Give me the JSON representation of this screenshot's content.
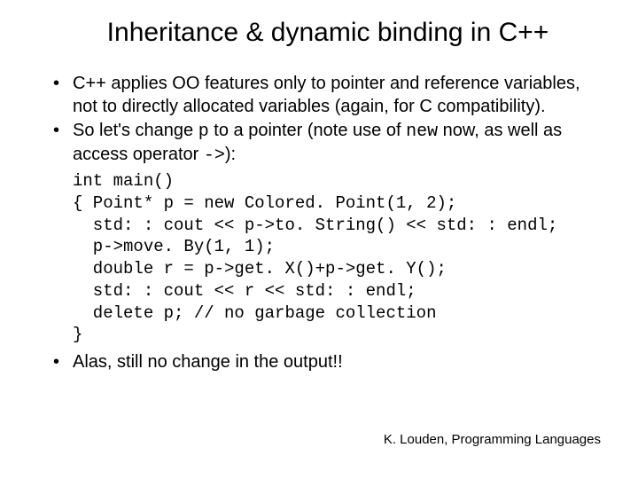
{
  "title": "Inheritance & dynamic binding in C++",
  "bullet1_a": "C++ applies OO features only to pointer and reference variables, not to directly allocated variables (again, for C compatibility).",
  "bullet2_a": "So let's change ",
  "bullet2_code1": "p",
  "bullet2_b": " to a pointer (note use of ",
  "bullet2_code2": "new",
  "bullet2_c": " now, as well as access operator ",
  "bullet2_code3": "->",
  "bullet2_d": "):",
  "code": "int main()\n{ Point* p = new Colored. Point(1, 2);\n  std: : cout << p->to. String() << std: : endl;\n  p->move. By(1, 1);\n  double r = p->get. X()+p->get. Y();\n  std: : cout << r << std: : endl;\n  delete p; // no garbage collection\n}",
  "bullet3": "Alas, still no change in the output!!",
  "footer": "K. Louden, Programming Languages"
}
